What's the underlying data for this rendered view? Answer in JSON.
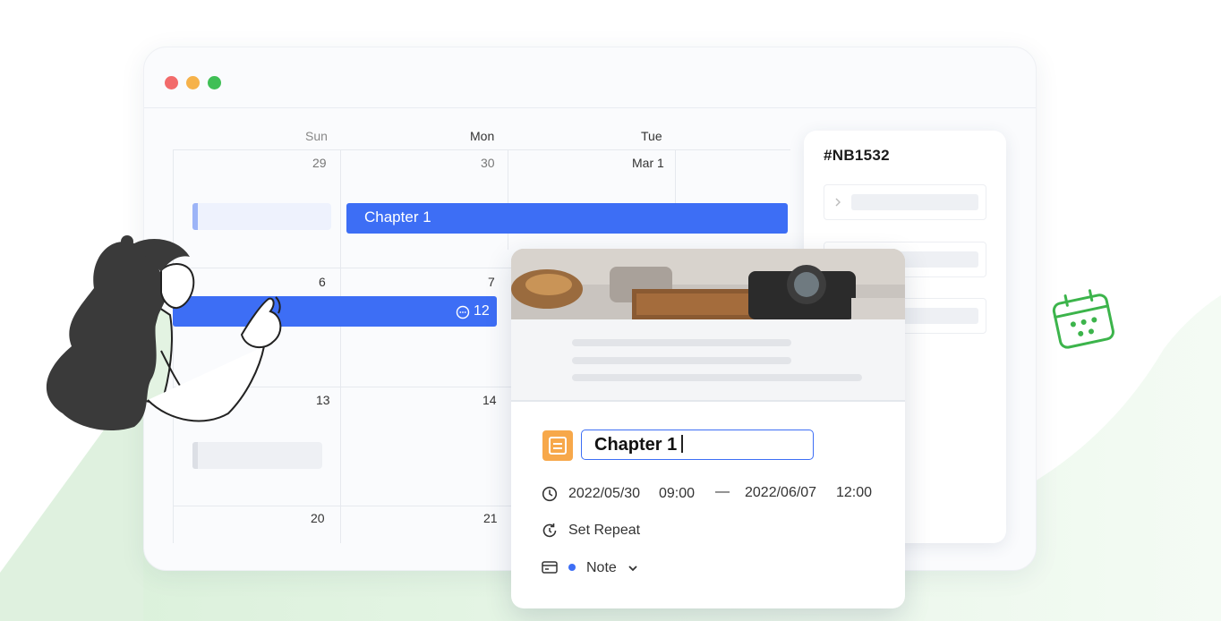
{
  "calendar": {
    "weekdays": [
      "Sun",
      "Mon",
      "Tue"
    ],
    "dates": {
      "r1": [
        "29",
        "30",
        "Mar 1"
      ],
      "r2": [
        "6",
        "7"
      ],
      "r3": [
        "13",
        "14"
      ],
      "r4": [
        "20",
        "21"
      ]
    },
    "events": {
      "chapter_bar": "Chapter 1",
      "comment_count": "12"
    }
  },
  "side_panel": {
    "title": "#NB1532"
  },
  "event_card": {
    "title_value": "Chapter 1",
    "start_date": "2022/05/30",
    "start_time": "09:00",
    "range_separator": "—",
    "end_date": "2022/06/07",
    "end_time": "12:00",
    "repeat_label": "Set Repeat",
    "category_label": "Note",
    "category_color": "#3d6ef5"
  },
  "colors": {
    "accent": "#3d6ef5",
    "title_icon": "#f7a84a",
    "floating_icon": "#3cb44b",
    "window_close": "#f26b6b",
    "window_minimize": "#f6b24a",
    "window_maximize": "#3fbf55"
  },
  "icons": [
    "comment-icon",
    "clock-icon",
    "repeat-icon",
    "card-icon",
    "chevron-down-icon",
    "chevron-right-icon",
    "calendar-icon",
    "document-icon"
  ]
}
